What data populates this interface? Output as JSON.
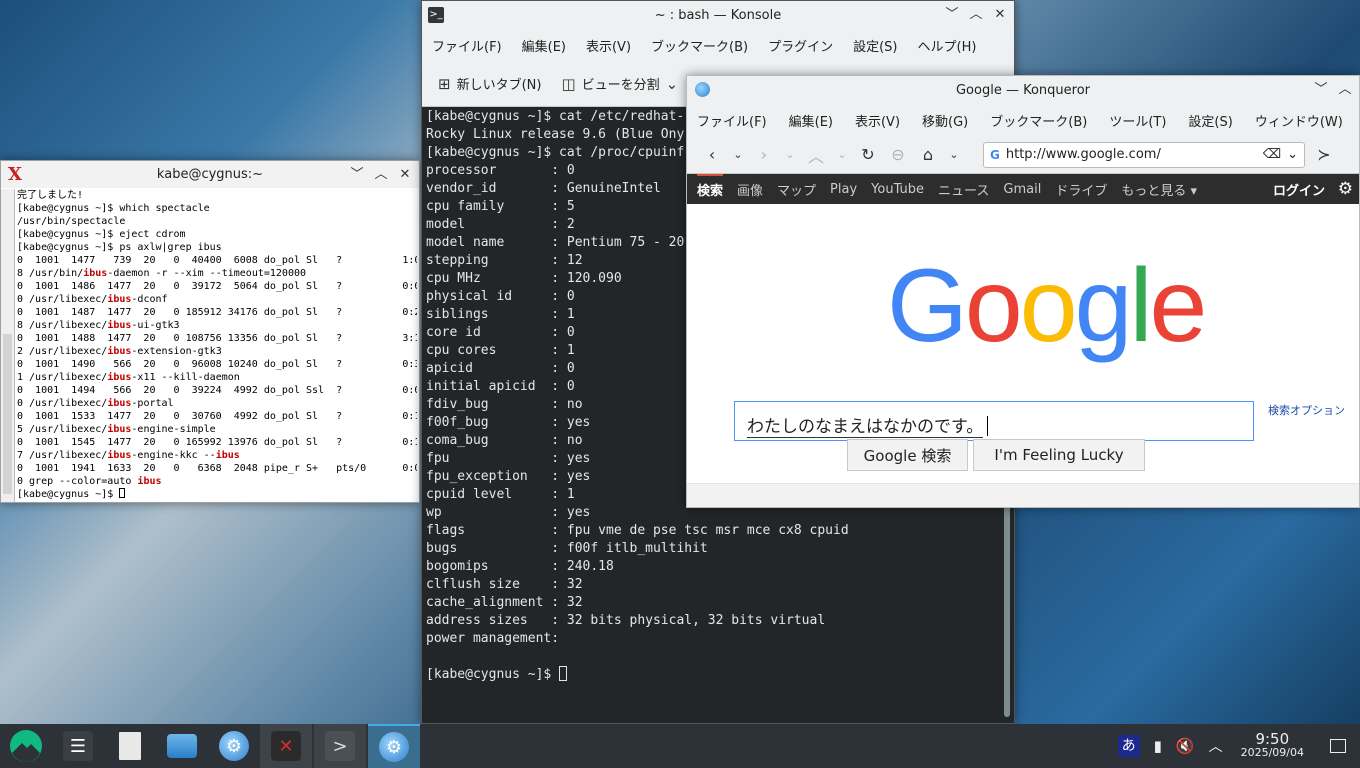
{
  "xterm": {
    "title": "kabe@cygnus:~",
    "icon": "x-icon",
    "lines": [
      [
        {
          "t": "完了しました!"
        }
      ],
      [
        {
          "t": "[kabe@cygnus ~]$ which spectacle"
        }
      ],
      [
        {
          "t": "/usr/bin/spectacle"
        }
      ],
      [
        {
          "t": "[kabe@cygnus ~]$ eject cdrom"
        }
      ],
      [
        {
          "t": "[kabe@cygnus ~]$ ps axlw|grep ibus"
        }
      ],
      [
        {
          "t": "0  1001  1477   739  20   0  40400  6008 do_pol Sl   ?          1:0"
        }
      ],
      [
        {
          "t": "8 /usr/bin/"
        },
        {
          "t": "ibus",
          "h": true
        },
        {
          "t": "-daemon -r --xim --timeout=120000"
        }
      ],
      [
        {
          "t": "0  1001  1486  1477  20   0  39172  5064 do_pol Sl   ?          0:0"
        }
      ],
      [
        {
          "t": "0 /usr/libexec/"
        },
        {
          "t": "ibus",
          "h": true
        },
        {
          "t": "-dconf"
        }
      ],
      [
        {
          "t": "0  1001  1487  1477  20   0 185912 34176 do_pol Sl   ?          0:2"
        }
      ],
      [
        {
          "t": "8 /usr/libexec/"
        },
        {
          "t": "ibus",
          "h": true
        },
        {
          "t": "-ui-gtk3"
        }
      ],
      [
        {
          "t": "0  1001  1488  1477  20   0 108756 13356 do_pol Sl   ?          3:1"
        }
      ],
      [
        {
          "t": "2 /usr/libexec/"
        },
        {
          "t": "ibus",
          "h": true
        },
        {
          "t": "-extension-gtk3"
        }
      ],
      [
        {
          "t": "0  1001  1490   566  20   0  96008 10240 do_pol Sl   ?          0:3"
        }
      ],
      [
        {
          "t": "1 /usr/libexec/"
        },
        {
          "t": "ibus",
          "h": true
        },
        {
          "t": "-x11 --kill-daemon"
        }
      ],
      [
        {
          "t": "0  1001  1494   566  20   0  39224  4992 do_pol Ssl  ?          0:0"
        }
      ],
      [
        {
          "t": "0 /usr/libexec/"
        },
        {
          "t": "ibus",
          "h": true
        },
        {
          "t": "-portal"
        }
      ],
      [
        {
          "t": "0  1001  1533  1477  20   0  30760  4992 do_pol Sl   ?          0:1"
        }
      ],
      [
        {
          "t": "5 /usr/libexec/"
        },
        {
          "t": "ibus",
          "h": true
        },
        {
          "t": "-engine-simple"
        }
      ],
      [
        {
          "t": "0  1001  1545  1477  20   0 165992 13976 do_pol Sl   ?          0:1"
        }
      ],
      [
        {
          "t": "7 /usr/libexec/"
        },
        {
          "t": "ibus",
          "h": true
        },
        {
          "t": "-engine-kkc --"
        },
        {
          "t": "ibus",
          "h": true
        }
      ],
      [
        {
          "t": "0  1001  1941  1633  20   0   6368  2048 pipe_r S+   pts/0      0:0"
        }
      ],
      [
        {
          "t": "0 grep --color=auto "
        },
        {
          "t": "ibus",
          "h": true
        }
      ],
      [
        {
          "t": "[kabe@cygnus ~]$ "
        },
        {
          "cursor": true
        }
      ]
    ]
  },
  "konsole": {
    "title": "~ : bash — Konsole",
    "menu": [
      "ファイル(F)",
      "編集(E)",
      "表示(V)",
      "ブックマーク(B)",
      "プラグイン",
      "設定(S)",
      "ヘルプ(H)"
    ],
    "toolbar": {
      "new_tab": "新しいタブ(N)",
      "split_view": "ビューを分割"
    },
    "lines": [
      "[kabe@cygnus ~]$ cat /etc/redhat-",
      "Rocky Linux release 9.6 (Blue Ony",
      "[kabe@cygnus ~]$ cat /proc/cpuinf",
      "processor       : 0",
      "vendor_id       : GenuineIntel",
      "cpu family      : 5",
      "model           : 2",
      "model name      : Pentium 75 - 20",
      "stepping        : 12",
      "cpu MHz         : 120.090",
      "physical id     : 0",
      "siblings        : 1",
      "core id         : 0",
      "cpu cores       : 1",
      "apicid          : 0",
      "initial apicid  : 0",
      "fdiv_bug        : no",
      "f00f_bug        : yes",
      "coma_bug        : no",
      "fpu             : yes",
      "fpu_exception   : yes",
      "cpuid level     : 1",
      "wp              : yes",
      "flags           : fpu vme de pse tsc msr mce cx8 cpuid",
      "bugs            : f00f itlb_multihit",
      "bogomips        : 240.18",
      "clflush size    : 32",
      "cache_alignment : 32",
      "address sizes   : 32 bits physical, 32 bits virtual",
      "power management:",
      ""
    ],
    "prompt": "[kabe@cygnus ~]$ "
  },
  "konqueror": {
    "title": "Google — Konqueror",
    "menu": [
      "ファイル(F)",
      "編集(E)",
      "表示(V)",
      "移動(G)",
      "ブックマーク(B)",
      "ツール(T)",
      "設定(S)",
      "ウィンドウ(W)"
    ],
    "url": "http://www.google.com/",
    "google_bar": [
      "検索",
      "画像",
      "マップ",
      "Play",
      "YouTube",
      "ニュース",
      "Gmail",
      "ドライブ",
      "もっと見る ▾"
    ],
    "login": "ログイン",
    "search_text": "わたしのなまえはなかのです。",
    "search_options": "検索オプション",
    "btn_search": "Google 検索",
    "btn_lucky": "I'm Feeling Lucky",
    "logo_colors": [
      "#4285f4",
      "#ea4335",
      "#fbbc05",
      "#4285f4",
      "#34a853",
      "#ea4335"
    ]
  },
  "taskbar": {
    "time": "9:50",
    "date": "2025/09/04",
    "ime": "あ"
  }
}
